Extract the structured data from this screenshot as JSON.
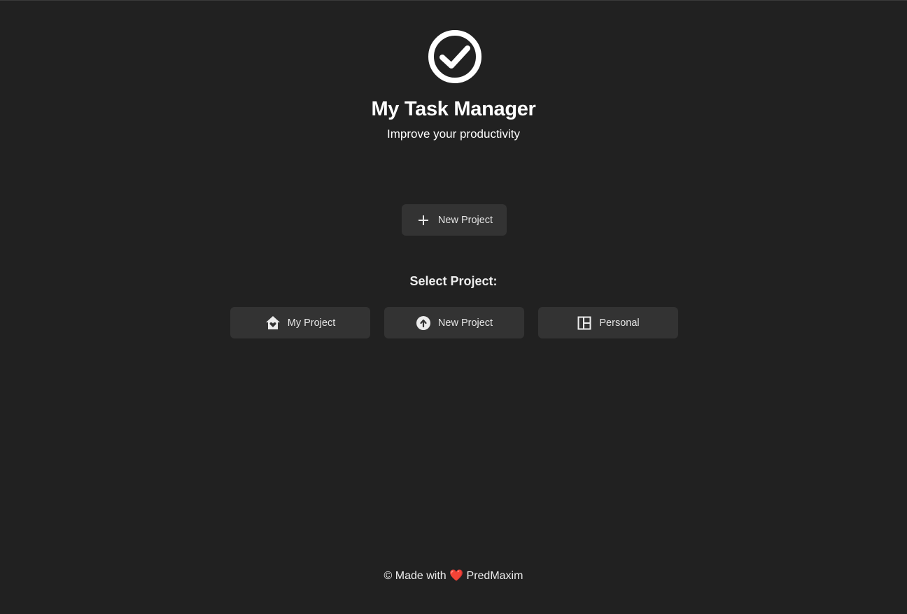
{
  "app": {
    "title": "My Task Manager",
    "subtitle": "Improve your productivity",
    "logo_icon": "check-circle-icon"
  },
  "actions": {
    "new_project_label": "New Project",
    "new_project_icon": "plus-icon"
  },
  "projects": {
    "heading": "Select Project:",
    "items": [
      {
        "label": "My Project",
        "icon": "house-heart-icon"
      },
      {
        "label": "New Project",
        "icon": "arrow-up-circle-icon"
      },
      {
        "label": "Personal",
        "icon": "dashboard-layout-icon"
      }
    ]
  },
  "footer": {
    "prefix": "© Made with",
    "heart": "❤️",
    "author": "PredMaxim"
  },
  "colors": {
    "background": "#212121",
    "button": "#333333",
    "text": "#ffffff",
    "heart": "#e53935"
  }
}
